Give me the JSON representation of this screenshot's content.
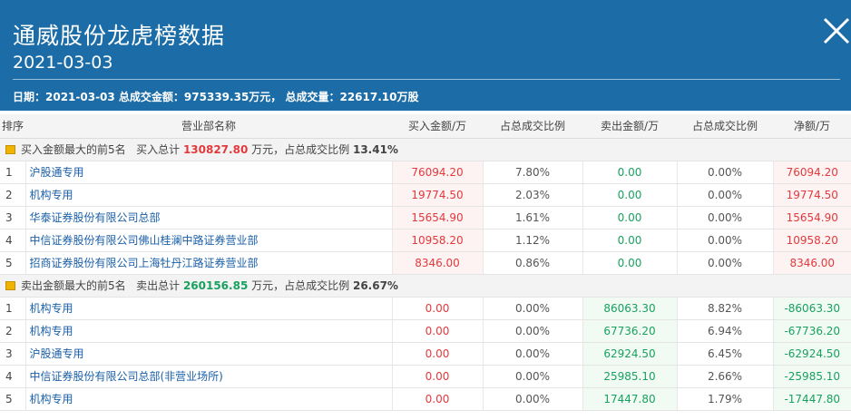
{
  "header": {
    "title": "通威股份龙虎榜数据",
    "date": "2021-03-03",
    "summary": "日期：2021-03-03 总成交金额：975339.35万元， 总成交量：22617.10万股"
  },
  "table": {
    "columns": [
      "排序",
      "营业部名称",
      "买入金额/万",
      "占总成交比例",
      "卖出金额/万",
      "占总成交比例",
      "净额/万"
    ],
    "buy_section": {
      "prefix": "买入金额最大的前5名",
      "total_label": "买入总计",
      "total_value": "130827.80",
      "unit_ratio_label": "万元，占总成交比例",
      "ratio": "13.41%"
    },
    "buy_rows": [
      {
        "rank": "1",
        "name": "沪股通专用",
        "buy": "76094.20",
        "buy_pct": "7.80%",
        "sell": "0.00",
        "sell_pct": "0.00%",
        "net": "76094.20"
      },
      {
        "rank": "2",
        "name": "机构专用",
        "buy": "19774.50",
        "buy_pct": "2.03%",
        "sell": "0.00",
        "sell_pct": "0.00%",
        "net": "19774.50"
      },
      {
        "rank": "3",
        "name": "华泰证券股份有限公司总部",
        "buy": "15654.90",
        "buy_pct": "1.61%",
        "sell": "0.00",
        "sell_pct": "0.00%",
        "net": "15654.90"
      },
      {
        "rank": "4",
        "name": "中信证券股份有限公司佛山桂澜中路证券营业部",
        "buy": "10958.20",
        "buy_pct": "1.12%",
        "sell": "0.00",
        "sell_pct": "0.00%",
        "net": "10958.20"
      },
      {
        "rank": "5",
        "name": "招商证券股份有限公司上海牡丹江路证券营业部",
        "buy": "8346.00",
        "buy_pct": "0.86%",
        "sell": "0.00",
        "sell_pct": "0.00%",
        "net": "8346.00"
      }
    ],
    "sell_section": {
      "prefix": "卖出金额最大的前5名",
      "total_label": "卖出总计",
      "total_value": "260156.85",
      "unit_ratio_label": "万元，占总成交比例",
      "ratio": "26.67%"
    },
    "sell_rows": [
      {
        "rank": "1",
        "name": "机构专用",
        "buy": "0.00",
        "buy_pct": "0.00%",
        "sell": "86063.30",
        "sell_pct": "8.82%",
        "net": "-86063.30"
      },
      {
        "rank": "2",
        "name": "机构专用",
        "buy": "0.00",
        "buy_pct": "0.00%",
        "sell": "67736.20",
        "sell_pct": "6.94%",
        "net": "-67736.20"
      },
      {
        "rank": "3",
        "name": "沪股通专用",
        "buy": "0.00",
        "buy_pct": "0.00%",
        "sell": "62924.50",
        "sell_pct": "6.45%",
        "net": "-62924.50"
      },
      {
        "rank": "4",
        "name": "中信证券股份有限公司总部(非营业场所)",
        "buy": "0.00",
        "buy_pct": "0.00%",
        "sell": "25985.10",
        "sell_pct": "2.66%",
        "net": "-25985.10"
      },
      {
        "rank": "5",
        "name": "机构专用",
        "buy": "0.00",
        "buy_pct": "0.00%",
        "sell": "17447.80",
        "sell_pct": "1.79%",
        "net": "-17447.80"
      }
    ]
  },
  "colors": {
    "header_bg": "#1c6da7",
    "buy_red": "#e4393c",
    "sell_green": "#19a15f",
    "link_blue": "#1a5fa8"
  },
  "icons": {
    "close": "close-icon",
    "section": "section-icon"
  }
}
